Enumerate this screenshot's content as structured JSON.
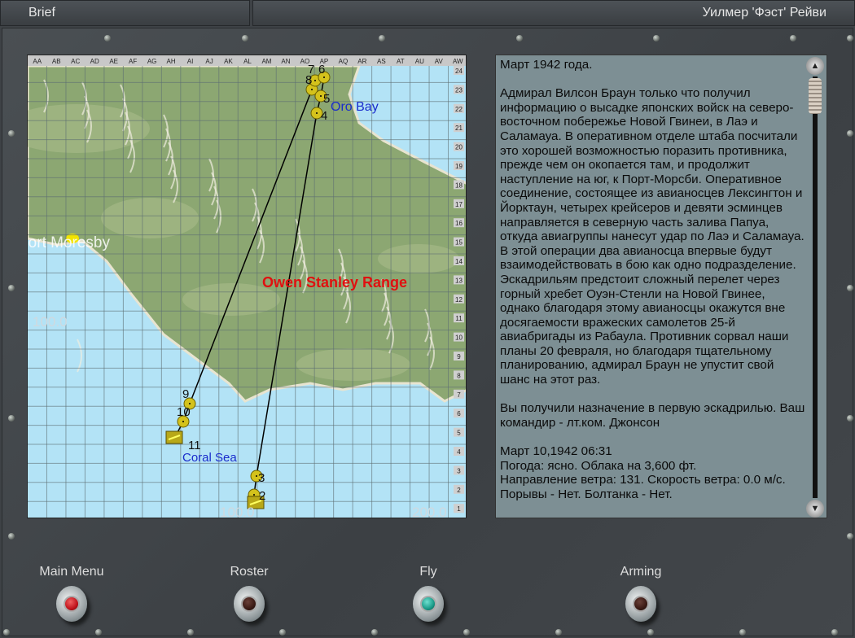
{
  "header": {
    "left_title": "Brief",
    "pilot_name": "Уилмер 'Фэст' Рейви"
  },
  "map": {
    "columns": [
      "AA",
      "AB",
      "AC",
      "AD",
      "AE",
      "AF",
      "AG",
      "AH",
      "AI",
      "AJ",
      "AK",
      "AL",
      "AM",
      "AN",
      "AO",
      "AP",
      "AQ",
      "AR",
      "AS",
      "AT",
      "AU",
      "AV",
      "AW"
    ],
    "rows": [
      "24",
      "23",
      "22",
      "21",
      "20",
      "19",
      "18",
      "17",
      "16",
      "15",
      "14",
      "13",
      "12",
      "11",
      "10",
      "9",
      "8",
      "7",
      "6",
      "5",
      "4",
      "3",
      "2",
      "1"
    ],
    "labels": {
      "range": "Owen Stanley Range",
      "oro_bay": "Oro Bay",
      "coral_sea": "Coral Sea",
      "port_moresby": "Port Moresby",
      "scale_left": "100.0",
      "scale_bottom_1": "100.0",
      "scale_bottom_2": "200.0"
    },
    "waypoints": [
      "2",
      "3",
      "4",
      "5",
      "6",
      "7",
      "8",
      "9",
      "10",
      "11"
    ],
    "colors": {
      "sea": "#b3e3f6",
      "land": "#8ca772",
      "route": "#000000",
      "waypoint": "#d4c21c",
      "range_label": "#e01010",
      "place_label": "#1a2ccc"
    }
  },
  "brief": {
    "text": "Март 1942 года.\n\nАдмирал Вилсон Браун только что получил информацию о высадке японских войск на северо-восточном побережье Новой Гвинеи, в Лаэ и Саламауа. В оперативном отделе штаба посчитали это хорошей возможностью поразить противника, прежде чем он окопается там, и продолжит наступление на юг, к Порт-Морсби. Оперативное соединение, состоящее из авианосцев Лексингтон и Йорктаун, четырех крейсеров и девяти эсминцев направляется в северную часть залива Папуа, откуда авиагруппы нанесут удар по Лаэ и Саламауа. В этой операции два авианосца впервые будут взаимодействовать в бою как одно подразделение. Эскадрильям предстоит сложный перелет через горный хребет Оуэн-Стенли на Новой Гвинее, однако благодаря этому авианосцы окажутся вне досягаемости вражеских самолетов 25-й авиабригады из Рабаула. Противник сорвал наши планы 20 февраля, но благодаря тщательному планированию, адмирал Браун не упустит свой шанс на этот раз.\n\nВы получили назначение в первую эскадрилью. Ваш командир - лт.ком. Джонсон\n\nМарт 10,1942 06:31\nПогода: ясно. Облака на 3,600 фт.\nНаправление ветра: 131. Скорость ветра: 0.0 м/с.\nПорывы - Нет. Болтанка - Нет."
  },
  "buttons": {
    "main_menu": "Main Menu",
    "roster": "Roster",
    "fly": "Fly",
    "arming": "Arming",
    "colors": {
      "main_menu": "#c0141c",
      "roster": "#3a1a14",
      "fly": "#1a9a88",
      "arming": "#3a1a14"
    }
  }
}
